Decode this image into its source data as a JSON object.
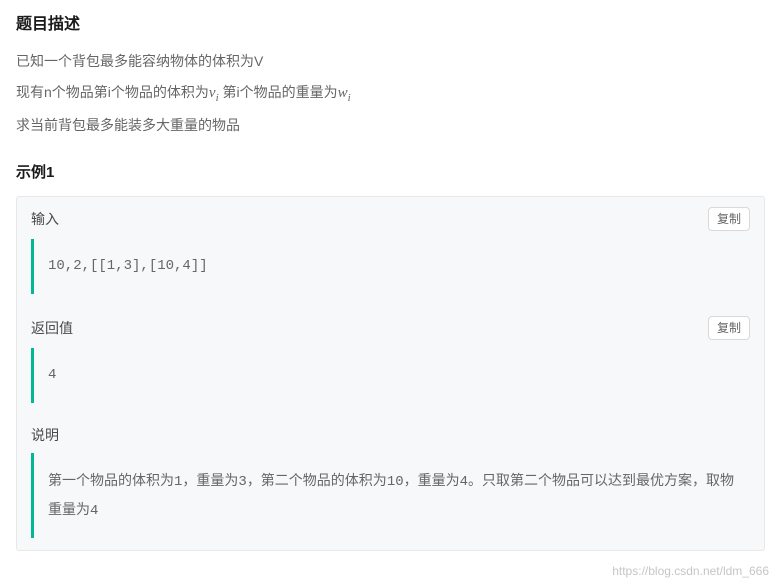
{
  "title": "题目描述",
  "description": {
    "line1_prefix": "已知一个背包最多能容纳物体的体积为V",
    "line2_a": "现有n个物品第i个物品的体积为",
    "line2_v": "v",
    "line2_vi": "i",
    "line2_b": " 第i个物品的重量为",
    "line2_w": "w",
    "line2_wi": "i",
    "line3": "求当前背包最多能装多大重量的物品"
  },
  "exampleTitle": "示例1",
  "sections": {
    "input": {
      "label": "输入",
      "copy": "复制",
      "content": "10,2,[[1,3],[10,4]]"
    },
    "output": {
      "label": "返回值",
      "copy": "复制",
      "content": "4"
    },
    "explain": {
      "label": "说明",
      "part1": "第一个物品的体积为",
      "v1": "1",
      "part2": "，重量为",
      "w1": "3",
      "part3": "，第二个物品的体积为",
      "v2": "10",
      "part4": "，重量为",
      "w2": "4",
      "part5": "。只取第二个物品可以达到最优方案，取物重量为",
      "ans": "4"
    }
  },
  "watermark": "https://blog.csdn.net/ldm_666"
}
